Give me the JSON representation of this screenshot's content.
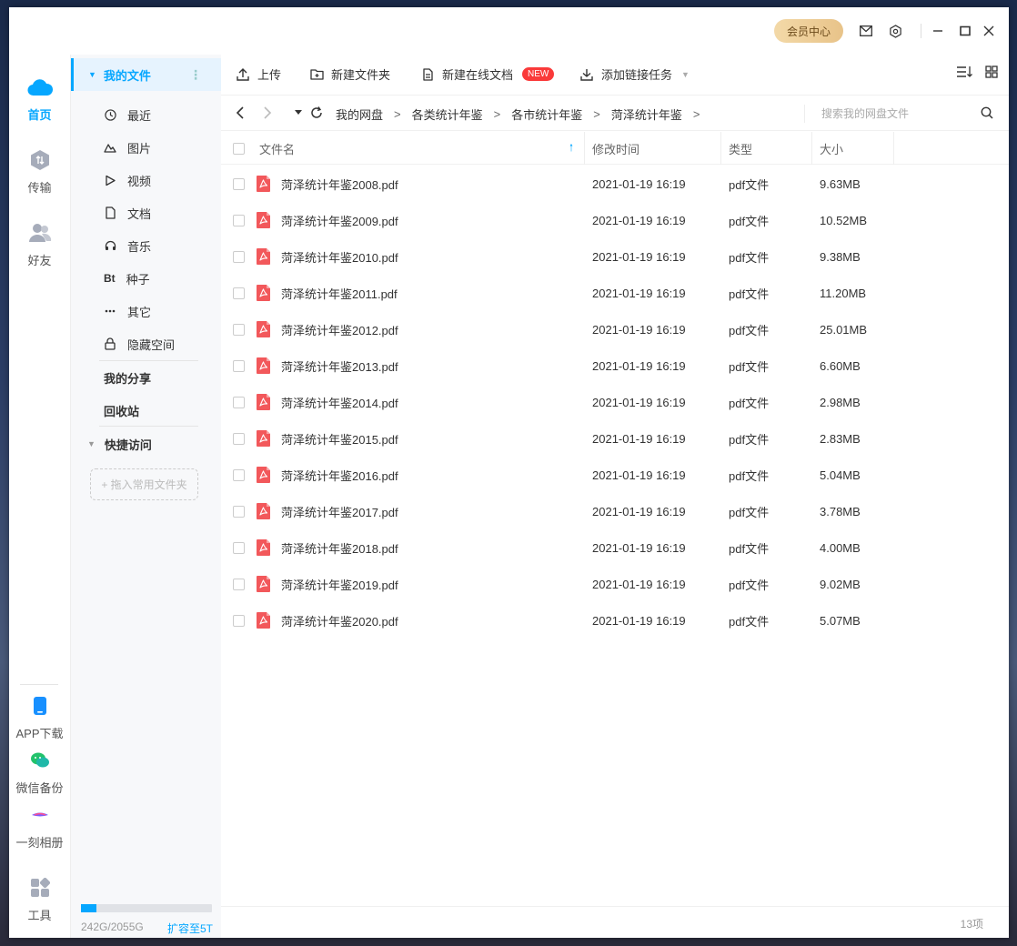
{
  "titlebar": {
    "vip_label": "会员中心"
  },
  "leftnav": {
    "items": [
      {
        "label": "首页",
        "icon": "cloud-icon"
      },
      {
        "label": "传输",
        "icon": "transfer-icon"
      },
      {
        "label": "好友",
        "icon": "friends-icon"
      }
    ],
    "bottom": [
      {
        "label": "APP下载",
        "icon": "phone-icon"
      },
      {
        "label": "微信备份",
        "icon": "wechat-icon"
      },
      {
        "label": "一刻相册",
        "icon": "album-icon"
      },
      {
        "label": "工具",
        "icon": "tools-icon"
      }
    ]
  },
  "sidebar": {
    "my_files": "我的文件",
    "items": [
      {
        "label": "最近",
        "icon": "clock-icon"
      },
      {
        "label": "图片",
        "icon": "image-icon"
      },
      {
        "label": "视频",
        "icon": "video-icon"
      },
      {
        "label": "文档",
        "icon": "document-icon"
      },
      {
        "label": "音乐",
        "icon": "headphones-icon"
      },
      {
        "label": "种子",
        "icon": "bt-icon"
      },
      {
        "label": "其它",
        "icon": "more-icon"
      },
      {
        "label": "隐藏空间",
        "icon": "lock-icon"
      }
    ],
    "my_share": "我的分享",
    "recycle": "回收站",
    "quick_access": "快捷访问",
    "drop_hint": "+ 拖入常用文件夹",
    "bt_glyph": "Bt",
    "quota": {
      "text": "242G/2055G",
      "used_fraction": 0.118,
      "expand": "扩容至5T"
    }
  },
  "toolbar": {
    "upload": "上传",
    "new_folder": "新建文件夹",
    "new_doc": "新建在线文档",
    "new_badge": "NEW",
    "add_link": "添加链接任务"
  },
  "path": {
    "crumbs": [
      "我的网盘",
      "各类统计年鉴",
      "各市统计年鉴",
      "菏泽统计年鉴"
    ],
    "separator": ">",
    "search_placeholder": "搜索我的网盘文件"
  },
  "table": {
    "headers": {
      "name": "文件名",
      "mtime": "修改时间",
      "type": "类型",
      "size": "大小"
    },
    "rows": [
      {
        "name": "菏泽统计年鉴2008.pdf",
        "mtime": "2021-01-19 16:19",
        "type": "pdf文件",
        "size": "9.63MB"
      },
      {
        "name": "菏泽统计年鉴2009.pdf",
        "mtime": "2021-01-19 16:19",
        "type": "pdf文件",
        "size": "10.52MB"
      },
      {
        "name": "菏泽统计年鉴2010.pdf",
        "mtime": "2021-01-19 16:19",
        "type": "pdf文件",
        "size": "9.38MB"
      },
      {
        "name": "菏泽统计年鉴2011.pdf",
        "mtime": "2021-01-19 16:19",
        "type": "pdf文件",
        "size": "11.20MB"
      },
      {
        "name": "菏泽统计年鉴2012.pdf",
        "mtime": "2021-01-19 16:19",
        "type": "pdf文件",
        "size": "25.01MB"
      },
      {
        "name": "菏泽统计年鉴2013.pdf",
        "mtime": "2021-01-19 16:19",
        "type": "pdf文件",
        "size": "6.60MB"
      },
      {
        "name": "菏泽统计年鉴2014.pdf",
        "mtime": "2021-01-19 16:19",
        "type": "pdf文件",
        "size": "2.98MB"
      },
      {
        "name": "菏泽统计年鉴2015.pdf",
        "mtime": "2021-01-19 16:19",
        "type": "pdf文件",
        "size": "2.83MB"
      },
      {
        "name": "菏泽统计年鉴2016.pdf",
        "mtime": "2021-01-19 16:19",
        "type": "pdf文件",
        "size": "5.04MB"
      },
      {
        "name": "菏泽统计年鉴2017.pdf",
        "mtime": "2021-01-19 16:19",
        "type": "pdf文件",
        "size": "3.78MB"
      },
      {
        "name": "菏泽统计年鉴2018.pdf",
        "mtime": "2021-01-19 16:19",
        "type": "pdf文件",
        "size": "4.00MB"
      },
      {
        "name": "菏泽统计年鉴2019.pdf",
        "mtime": "2021-01-19 16:19",
        "type": "pdf文件",
        "size": "9.02MB"
      },
      {
        "name": "菏泽统计年鉴2020.pdf",
        "mtime": "2021-01-19 16:19",
        "type": "pdf文件",
        "size": "5.07MB"
      }
    ]
  },
  "status": {
    "count": "13项"
  },
  "colors": {
    "accent": "#06a7ff",
    "pdf": "#f2585b",
    "badge": "#fa3a3a"
  }
}
